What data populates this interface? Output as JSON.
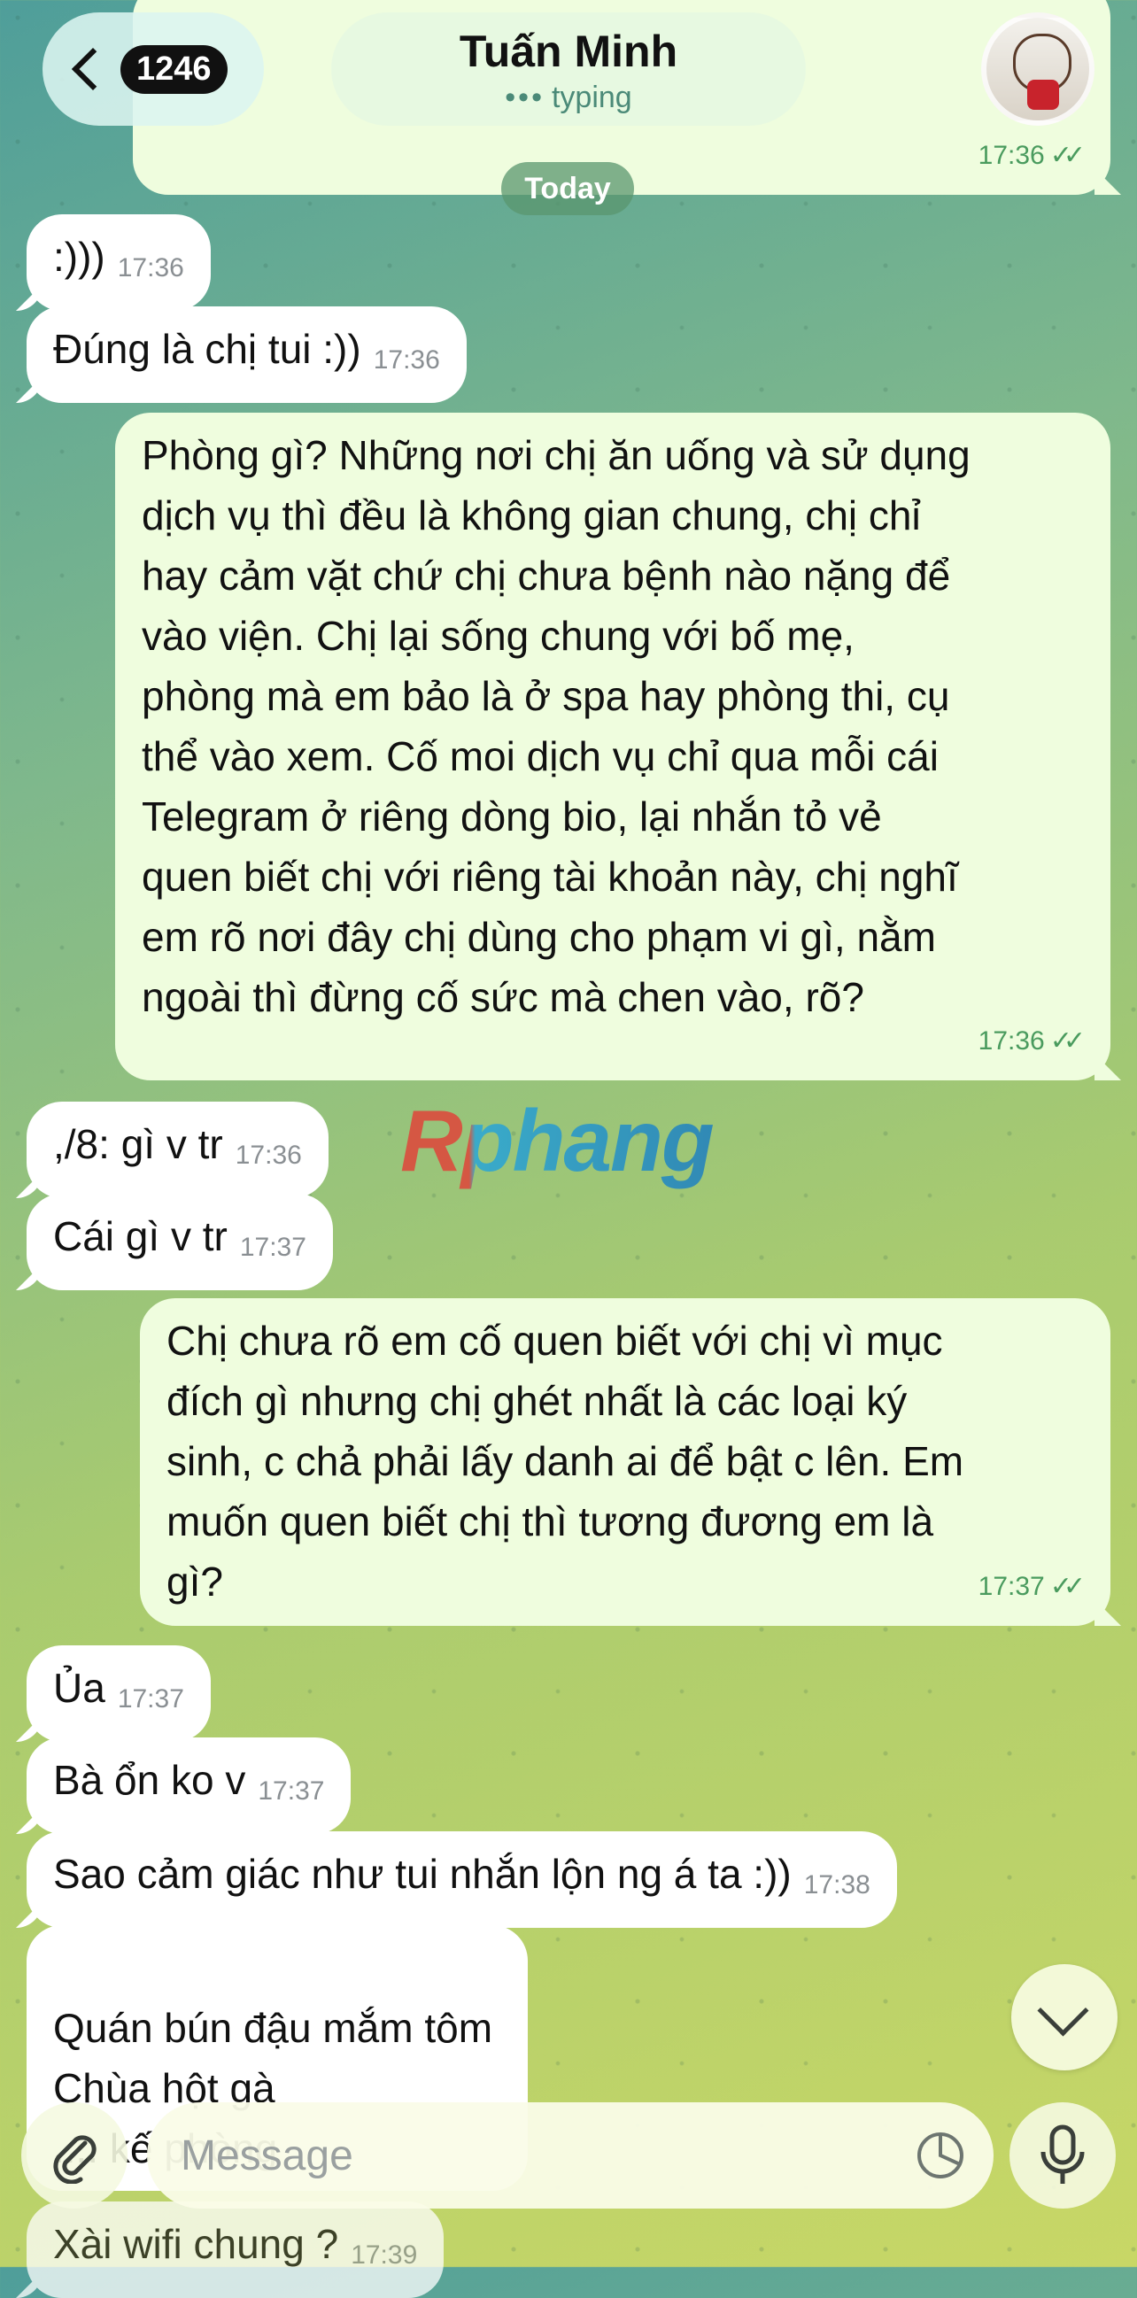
{
  "header": {
    "unread_count": "1246",
    "contact_name": "Tuấn Minh",
    "status": "typing",
    "avatar": "contact-avatar"
  },
  "top_partial": {
    "time": "17:36"
  },
  "date_separator": "Today",
  "messages": [
    {
      "side": "in",
      "text": ":)))",
      "time": "17:36"
    },
    {
      "side": "in",
      "text": "Đúng là chị tui :))",
      "time": "17:36"
    },
    {
      "side": "out",
      "text": "Phòng gì? Những nơi chị ăn uống và sử dụng\ndịch vụ thì đều là không gian chung, chị chỉ\nhay cảm vặt chứ chị chưa bệnh nào nặng để\nvào viện. Chị lại sống chung với bố mẹ,\nphòng mà em bảo là ở spa hay phòng thi, cụ\nthể vào xem. Cố moi dịch vụ chỉ qua mỗi cái\nTelegram ở riêng dòng bio, lại nhắn tỏ vẻ\nquen biết chị với riêng tài khoản này, chị nghĩ\nem rõ nơi đây chị dùng cho phạm vi gì, nằm\nngoài thì đừng cố sức mà chen vào, rõ?",
      "time": "17:36"
    },
    {
      "side": "in",
      "text": ",/8: gì v tr",
      "time": "17:36"
    },
    {
      "side": "in",
      "text": "Cái gì v tr",
      "time": "17:37"
    },
    {
      "side": "out",
      "text": "Chị chưa rõ em cố quen biết với chị vì mục\nđích gì nhưng chị ghét nhất là các loại ký\nsinh, c chả phải lấy danh ai để bật c lên. Em\nmuốn quen biết chị thì tương đương em là\ngì?",
      "time": "17:37"
    },
    {
      "side": "in",
      "text": "Ủa",
      "time": "17:37"
    },
    {
      "side": "in",
      "text": "Bà ổn ko v",
      "time": "17:37"
    },
    {
      "side": "in",
      "text": "Sao cảm giác như tui nhắn lộn ng á ta :))",
      "time": "17:38"
    },
    {
      "side": "in",
      "text": "Quán bún đậu mắm tôm\nChùa hột gà\n.... kế phòng",
      "time": ""
    },
    {
      "side": "in",
      "text": "Xài wifi chung ?",
      "time": "17:39"
    }
  ],
  "watermark": "Rphang",
  "composer": {
    "placeholder": "Message"
  },
  "colors": {
    "outgoing_bubble": "#effdde",
    "incoming_bubble": "#ffffff",
    "accent": "#4a9b5e"
  }
}
